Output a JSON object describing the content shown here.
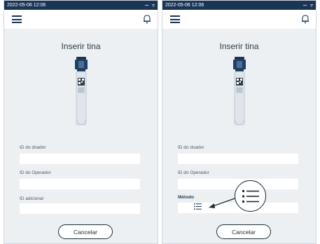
{
  "status_bar": {
    "time": "2022-05-06 12:06",
    "icons": [
      "wifi-icon",
      "signal-icon"
    ]
  },
  "screen": {
    "title": "Inserir tina",
    "fields": {
      "donor_id": {
        "label": "ID do doador",
        "value": ""
      },
      "operator_id": {
        "label": "ID do Operador",
        "value": ""
      },
      "additional_id": {
        "label": "ID adicional",
        "value": ""
      },
      "method": {
        "label": "Método",
        "value": ""
      }
    },
    "cancel_label": "Cancelar"
  },
  "annotation": {
    "zoomed_icon": "list-icon"
  },
  "colors": {
    "status_bar": "#1a3657",
    "background": "#edf0f3",
    "text": "#1c2d3a"
  }
}
